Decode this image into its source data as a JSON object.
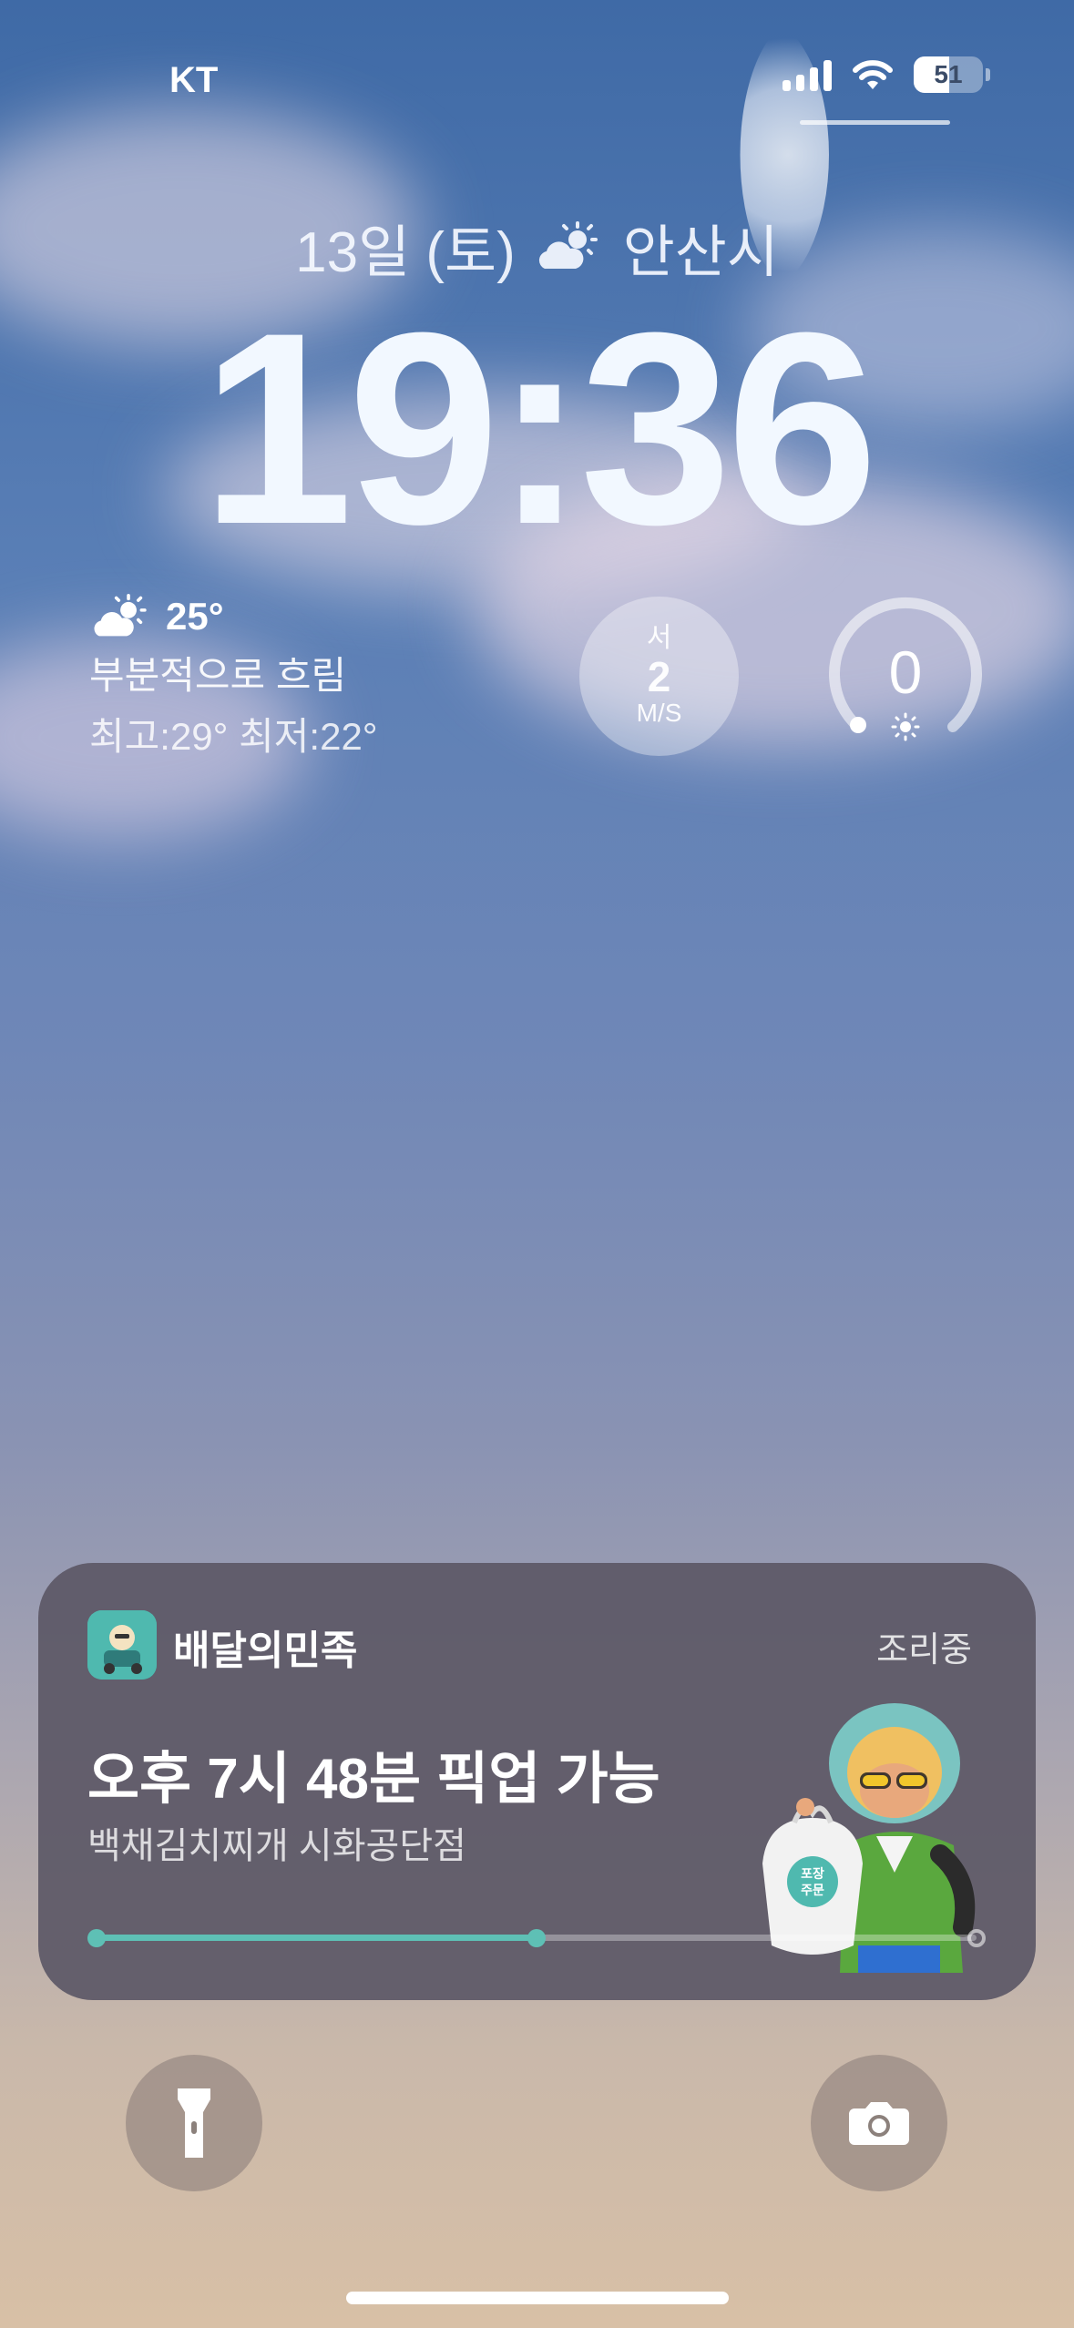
{
  "status_bar": {
    "carrier": "KT",
    "battery_level": "51",
    "battery_fraction": 0.51,
    "icons": [
      "cellular-signal-icon",
      "wifi-icon",
      "battery-icon"
    ]
  },
  "lock_screen": {
    "date": "13일 (토)",
    "date_weather_icon": "partly-sunny-icon",
    "location": "안산시",
    "time": "19:36"
  },
  "widgets": {
    "weather": {
      "icon": "partly-sunny-icon",
      "temperature": "25°",
      "condition": "부분적으로 흐림",
      "high_low": "최고:29° 최저:22°"
    },
    "wind": {
      "direction": "서",
      "speed": "2",
      "unit": "M/S"
    },
    "uv": {
      "value": "0",
      "icon": "sun-icon",
      "gauge_fraction": 0
    }
  },
  "live_activity": {
    "app_name": "배달의민족",
    "status": "조리중",
    "title": "오후 7시 48분 픽업 가능",
    "store": "백채김치찌개 시화공단점",
    "progress_fraction": 0.5,
    "accent_color": "#5ec0b5",
    "illustration": "character-holding-bag",
    "bag_label": "포장주문"
  },
  "bottom_controls": {
    "left_icon": "flashlight-icon",
    "right_icon": "camera-icon"
  }
}
